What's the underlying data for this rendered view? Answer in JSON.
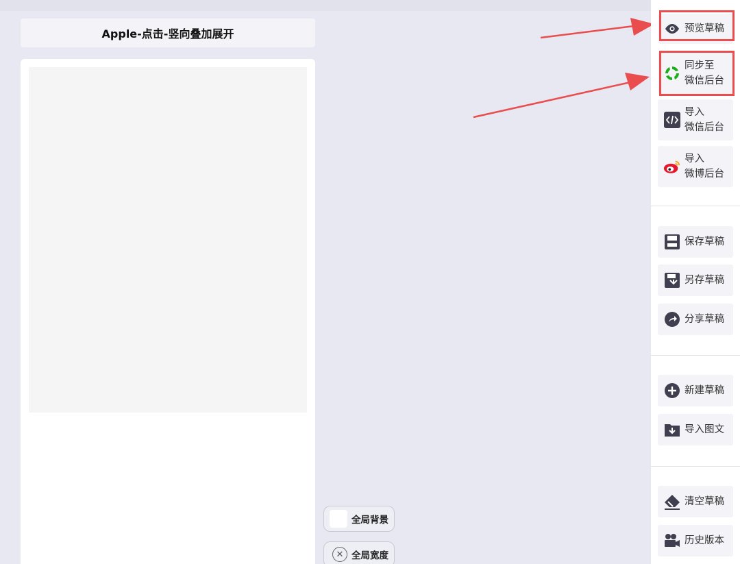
{
  "editor": {
    "title": "Apple-点击-竖向叠加展开"
  },
  "floating": {
    "global_background_label": "全局背景",
    "global_width_label": "全局宽度"
  },
  "sidebar": {
    "preview_draft": "预览草稿",
    "sync_wechat_line1": "同步至",
    "sync_wechat_line2": "微信后台",
    "import_wechat_line1": "导入",
    "import_wechat_line2": "微信后台",
    "import_weibo_line1": "导入",
    "import_weibo_line2": "微博后台",
    "save_draft": "保存草稿",
    "save_as_draft": "另存草稿",
    "share_draft": "分享草稿",
    "new_draft": "新建草稿",
    "import_article": "导入图文",
    "clear_draft": "清空草稿",
    "history_version": "历史版本"
  },
  "colors": {
    "highlight": "#e94d4d",
    "wechat_green": "#1aad19",
    "icon_dark": "#3f3f4f"
  }
}
